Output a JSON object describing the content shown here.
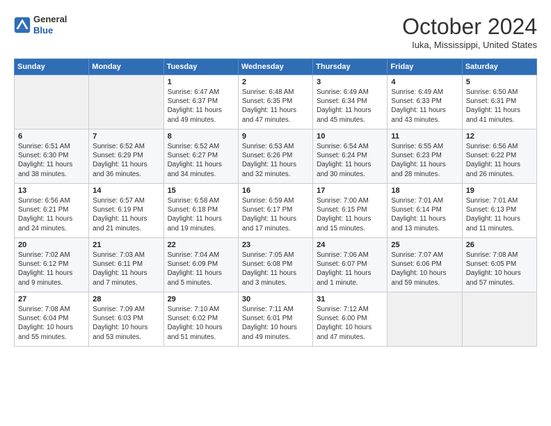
{
  "header": {
    "logo_general": "General",
    "logo_blue": "Blue",
    "month_title": "October 2024",
    "location": "Iuka, Mississippi, United States"
  },
  "days_of_week": [
    "Sunday",
    "Monday",
    "Tuesday",
    "Wednesday",
    "Thursday",
    "Friday",
    "Saturday"
  ],
  "weeks": [
    [
      {
        "day": "",
        "empty": true
      },
      {
        "day": "",
        "empty": true
      },
      {
        "day": "1",
        "sunrise": "Sunrise: 6:47 AM",
        "sunset": "Sunset: 6:37 PM",
        "daylight": "Daylight: 11 hours and 49 minutes."
      },
      {
        "day": "2",
        "sunrise": "Sunrise: 6:48 AM",
        "sunset": "Sunset: 6:35 PM",
        "daylight": "Daylight: 11 hours and 47 minutes."
      },
      {
        "day": "3",
        "sunrise": "Sunrise: 6:49 AM",
        "sunset": "Sunset: 6:34 PM",
        "daylight": "Daylight: 11 hours and 45 minutes."
      },
      {
        "day": "4",
        "sunrise": "Sunrise: 6:49 AM",
        "sunset": "Sunset: 6:33 PM",
        "daylight": "Daylight: 11 hours and 43 minutes."
      },
      {
        "day": "5",
        "sunrise": "Sunrise: 6:50 AM",
        "sunset": "Sunset: 6:31 PM",
        "daylight": "Daylight: 11 hours and 41 minutes."
      }
    ],
    [
      {
        "day": "6",
        "sunrise": "Sunrise: 6:51 AM",
        "sunset": "Sunset: 6:30 PM",
        "daylight": "Daylight: 11 hours and 38 minutes."
      },
      {
        "day": "7",
        "sunrise": "Sunrise: 6:52 AM",
        "sunset": "Sunset: 6:29 PM",
        "daylight": "Daylight: 11 hours and 36 minutes."
      },
      {
        "day": "8",
        "sunrise": "Sunrise: 6:52 AM",
        "sunset": "Sunset: 6:27 PM",
        "daylight": "Daylight: 11 hours and 34 minutes."
      },
      {
        "day": "9",
        "sunrise": "Sunrise: 6:53 AM",
        "sunset": "Sunset: 6:26 PM",
        "daylight": "Daylight: 11 hours and 32 minutes."
      },
      {
        "day": "10",
        "sunrise": "Sunrise: 6:54 AM",
        "sunset": "Sunset: 6:24 PM",
        "daylight": "Daylight: 11 hours and 30 minutes."
      },
      {
        "day": "11",
        "sunrise": "Sunrise: 6:55 AM",
        "sunset": "Sunset: 6:23 PM",
        "daylight": "Daylight: 11 hours and 28 minutes."
      },
      {
        "day": "12",
        "sunrise": "Sunrise: 6:56 AM",
        "sunset": "Sunset: 6:22 PM",
        "daylight": "Daylight: 11 hours and 26 minutes."
      }
    ],
    [
      {
        "day": "13",
        "sunrise": "Sunrise: 6:56 AM",
        "sunset": "Sunset: 6:21 PM",
        "daylight": "Daylight: 11 hours and 24 minutes."
      },
      {
        "day": "14",
        "sunrise": "Sunrise: 6:57 AM",
        "sunset": "Sunset: 6:19 PM",
        "daylight": "Daylight: 11 hours and 21 minutes."
      },
      {
        "day": "15",
        "sunrise": "Sunrise: 6:58 AM",
        "sunset": "Sunset: 6:18 PM",
        "daylight": "Daylight: 11 hours and 19 minutes."
      },
      {
        "day": "16",
        "sunrise": "Sunrise: 6:59 AM",
        "sunset": "Sunset: 6:17 PM",
        "daylight": "Daylight: 11 hours and 17 minutes."
      },
      {
        "day": "17",
        "sunrise": "Sunrise: 7:00 AM",
        "sunset": "Sunset: 6:15 PM",
        "daylight": "Daylight: 11 hours and 15 minutes."
      },
      {
        "day": "18",
        "sunrise": "Sunrise: 7:01 AM",
        "sunset": "Sunset: 6:14 PM",
        "daylight": "Daylight: 11 hours and 13 minutes."
      },
      {
        "day": "19",
        "sunrise": "Sunrise: 7:01 AM",
        "sunset": "Sunset: 6:13 PM",
        "daylight": "Daylight: 11 hours and 11 minutes."
      }
    ],
    [
      {
        "day": "20",
        "sunrise": "Sunrise: 7:02 AM",
        "sunset": "Sunset: 6:12 PM",
        "daylight": "Daylight: 11 hours and 9 minutes."
      },
      {
        "day": "21",
        "sunrise": "Sunrise: 7:03 AM",
        "sunset": "Sunset: 6:11 PM",
        "daylight": "Daylight: 11 hours and 7 minutes."
      },
      {
        "day": "22",
        "sunrise": "Sunrise: 7:04 AM",
        "sunset": "Sunset: 6:09 PM",
        "daylight": "Daylight: 11 hours and 5 minutes."
      },
      {
        "day": "23",
        "sunrise": "Sunrise: 7:05 AM",
        "sunset": "Sunset: 6:08 PM",
        "daylight": "Daylight: 11 hours and 3 minutes."
      },
      {
        "day": "24",
        "sunrise": "Sunrise: 7:06 AM",
        "sunset": "Sunset: 6:07 PM",
        "daylight": "Daylight: 11 hours and 1 minute."
      },
      {
        "day": "25",
        "sunrise": "Sunrise: 7:07 AM",
        "sunset": "Sunset: 6:06 PM",
        "daylight": "Daylight: 10 hours and 59 minutes."
      },
      {
        "day": "26",
        "sunrise": "Sunrise: 7:08 AM",
        "sunset": "Sunset: 6:05 PM",
        "daylight": "Daylight: 10 hours and 57 minutes."
      }
    ],
    [
      {
        "day": "27",
        "sunrise": "Sunrise: 7:08 AM",
        "sunset": "Sunset: 6:04 PM",
        "daylight": "Daylight: 10 hours and 55 minutes."
      },
      {
        "day": "28",
        "sunrise": "Sunrise: 7:09 AM",
        "sunset": "Sunset: 6:03 PM",
        "daylight": "Daylight: 10 hours and 53 minutes."
      },
      {
        "day": "29",
        "sunrise": "Sunrise: 7:10 AM",
        "sunset": "Sunset: 6:02 PM",
        "daylight": "Daylight: 10 hours and 51 minutes."
      },
      {
        "day": "30",
        "sunrise": "Sunrise: 7:11 AM",
        "sunset": "Sunset: 6:01 PM",
        "daylight": "Daylight: 10 hours and 49 minutes."
      },
      {
        "day": "31",
        "sunrise": "Sunrise: 7:12 AM",
        "sunset": "Sunset: 6:00 PM",
        "daylight": "Daylight: 10 hours and 47 minutes."
      },
      {
        "day": "",
        "empty": true
      },
      {
        "day": "",
        "empty": true
      }
    ]
  ]
}
